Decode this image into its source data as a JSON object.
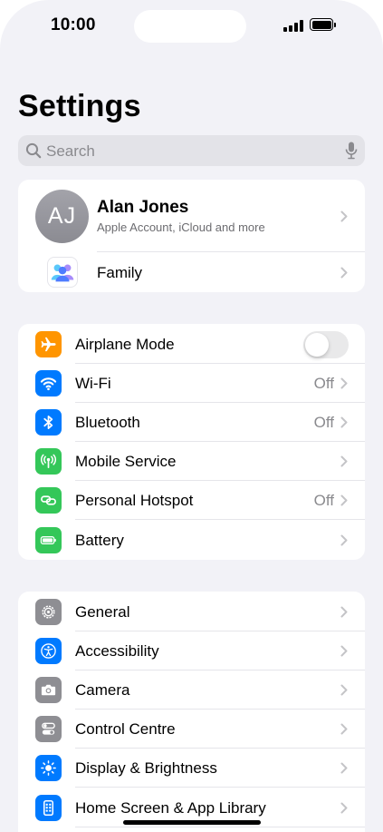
{
  "status_bar": {
    "time": "10:00"
  },
  "header": {
    "title": "Settings"
  },
  "search": {
    "placeholder": "Search"
  },
  "account": {
    "initials": "AJ",
    "name": "Alan Jones",
    "subtitle": "Apple Account, iCloud and more",
    "family_label": "Family"
  },
  "connectivity": {
    "airplane_mode": {
      "label": "Airplane Mode",
      "on": false
    },
    "wifi": {
      "label": "Wi-Fi",
      "value": "Off"
    },
    "bluetooth": {
      "label": "Bluetooth",
      "value": "Off"
    },
    "mobile_service": {
      "label": "Mobile Service"
    },
    "personal_hotspot": {
      "label": "Personal Hotspot",
      "value": "Off"
    },
    "battery": {
      "label": "Battery"
    }
  },
  "system": {
    "general": {
      "label": "General"
    },
    "accessibility": {
      "label": "Accessibility"
    },
    "camera": {
      "label": "Camera"
    },
    "control_centre": {
      "label": "Control Centre"
    },
    "display_brightness": {
      "label": "Display & Brightness"
    },
    "home_screen": {
      "label": "Home Screen & App Library"
    }
  },
  "colors": {
    "orange": "#ff9500",
    "blue": "#007aff",
    "green": "#34c759",
    "gray": "#8e8e93",
    "background": "#f2f2f7"
  }
}
